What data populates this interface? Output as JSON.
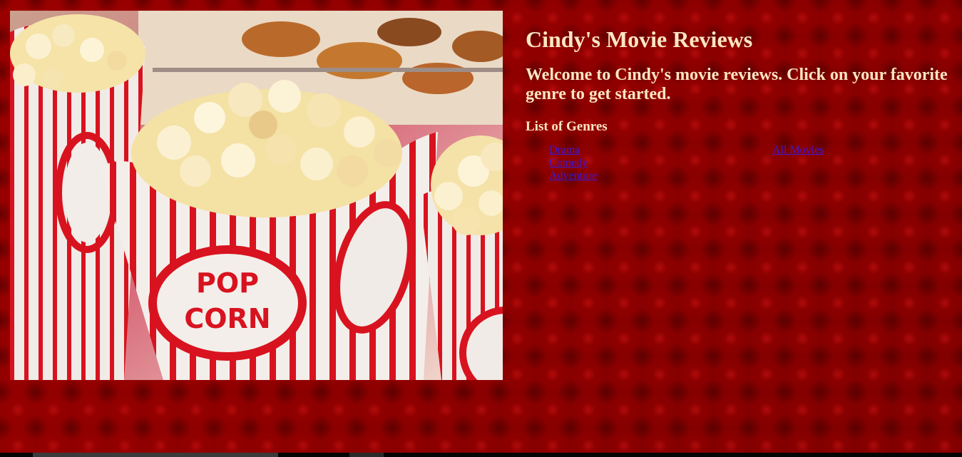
{
  "page": {
    "title": "Cindy's Movie Reviews",
    "welcome": "Welcome to Cindy's movie reviews. Click on your favorite genre to get started.",
    "genres_heading": "List of Genres"
  },
  "genres": {
    "left": [
      {
        "label": "Drama"
      },
      {
        "label": "Comedy"
      },
      {
        "label": "Adventure"
      }
    ],
    "right": [
      {
        "label": "All Movies"
      }
    ]
  },
  "hero_image": {
    "alt": "Popcorn boxes",
    "box_text_line1": "POP",
    "box_text_line2": "CORN"
  },
  "colors": {
    "background": "#8e0000",
    "heading_text": "#fde6c2",
    "link": "#3c1ad6",
    "box_red": "#d8131f"
  }
}
